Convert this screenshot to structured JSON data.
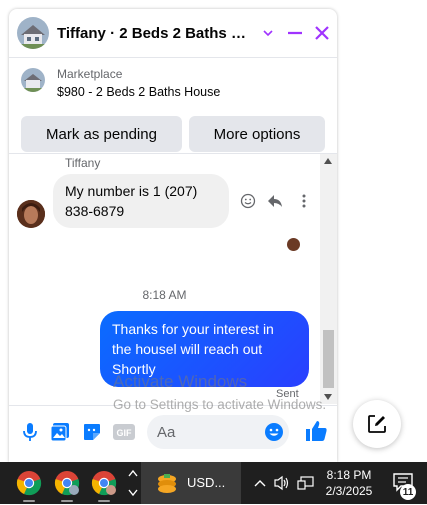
{
  "header": {
    "title": "Tiffany · 2 Beds 2 Baths House",
    "icons": [
      "chevron-down-icon",
      "minimize-icon",
      "close-icon"
    ]
  },
  "listing": {
    "source": "Marketplace",
    "title": "$980 - 2 Beds 2 Baths House",
    "pending_label": "Mark as pending",
    "more_label": "More options"
  },
  "messages": {
    "sender_name": "Tiffany",
    "incoming_text": "My number is 1 (207) 838-6879",
    "timestamp": "8:18 AM",
    "outgoing_text": "Thanks for your interest in the housel will reach out Shortly",
    "status": "Sent"
  },
  "composer": {
    "placeholder": "Aa"
  },
  "watermark": {
    "line1": "Activate Windows",
    "line2": "Go to Settings to activate Windows."
  },
  "taskbar": {
    "usd_label": "USD...",
    "time": "8:18 PM",
    "date": "2/3/2025",
    "notification_count": "11"
  },
  "colors": {
    "accent": "#a033ff",
    "outgoing_bubble": "#0a6cff",
    "like": "#0a7cff"
  }
}
